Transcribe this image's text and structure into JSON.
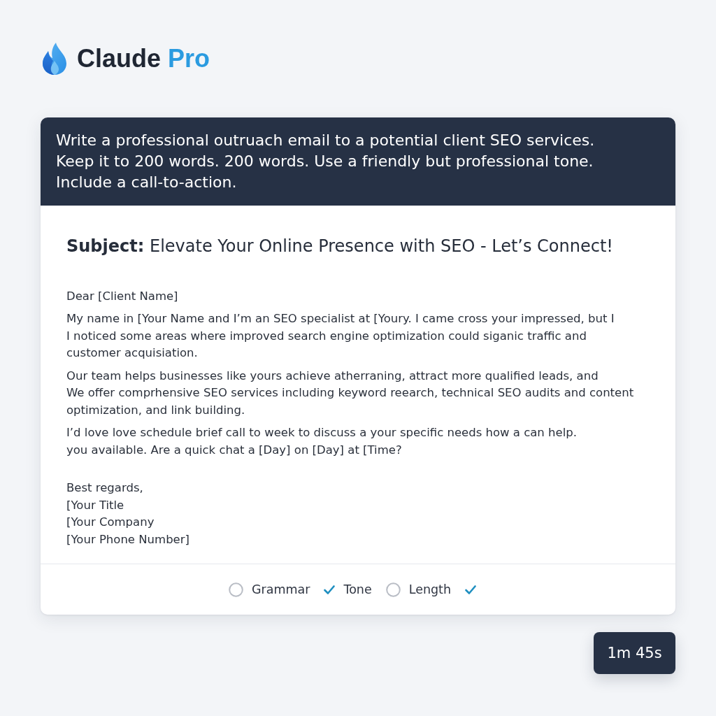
{
  "brand": {
    "name": "Claude",
    "accent": "Pro"
  },
  "prompt": {
    "lines": [
      "Write a professional outruach email to a potential client SEO services.",
      "Keep it to 200 words.  200 words. Use a friendly but professional tone.",
      "Include a call-to-action."
    ]
  },
  "email": {
    "subject": "**Subject:** Elevate Your Online Presence with SEO - Let’s Connect!",
    "greeting": "Dear [Client Name]",
    "paragraphs": [
      {
        "lines": [
          "My name in [Your Name and I’m an SEO specialist at [Youry. I came cross your impressed, but I",
          "I noticed some areas where improved search engine optimization could siganic traffic and",
          "customer acquisiation."
        ]
      },
      {
        "lines": [
          "Our team helps businesses like yours achieve atherraning, attract more qualified leads, and",
          "We offer comprhensive SEO services including keyword reearch, technical SEO audits and content",
          "optimization, and link building."
        ]
      },
      {
        "lines": [
          "I’d love love schedule brief call to week to discuss a your specific needs how a can help.",
          "you available. Are a quick chat a [Day] on [Day] at [Time?"
        ]
      }
    ],
    "signature": [
      "Best regards,",
      "[Your Title",
      "[Your Company",
      "[Your Phone Number]"
    ]
  },
  "checks": [
    {
      "label": "Grammar",
      "checked": false
    },
    {
      "label": "Tone",
      "checked": true
    },
    {
      "label": "Length",
      "checked": false
    },
    {
      "checked": true
    }
  ],
  "timer": "1m 45s"
}
